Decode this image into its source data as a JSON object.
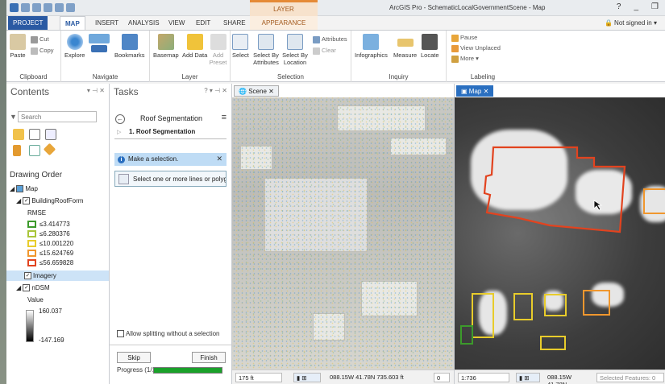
{
  "titlebar": {
    "app_title": "ArcGIS Pro - SchematicLocalGovernmentScene - Map",
    "context_tab": "LAYER",
    "help": "?",
    "minimize": "_",
    "maximize": "❐"
  },
  "tabs": [
    "PROJECT",
    "MAP",
    "INSERT",
    "ANALYSIS",
    "VIEW",
    "EDIT",
    "SHARE",
    "APPEARANCE"
  ],
  "signin": "Not signed in",
  "ribbon": {
    "clipboard": {
      "label": "Clipboard",
      "paste": "Paste",
      "cut": "Cut",
      "copy": "Copy"
    },
    "navigate": {
      "label": "Navigate",
      "explore": "Explore",
      "bookmarks": "Bookmarks"
    },
    "layer": {
      "label": "Layer",
      "basemap": "Basemap",
      "add_data": "Add Data",
      "add_preset": "Add Preset"
    },
    "selection": {
      "label": "Selection",
      "select": "Select",
      "by_attributes": "Select By Attributes",
      "by_location": "Select By Location",
      "attributes": "Attributes",
      "clear": "Clear"
    },
    "inquiry": {
      "label": "Inquiry",
      "infographics": "Infographics",
      "measure": "Measure",
      "locate": "Locate"
    },
    "labeling": {
      "label": "Labeling",
      "pause": "Pause",
      "view_unplaced": "View Unplaced",
      "more": "More"
    }
  },
  "contents": {
    "title": "Contents",
    "search_placeholder": "Search",
    "drawing_order": "Drawing Order",
    "map": "Map",
    "layer1": "BuildingRoofForm",
    "rmse": "RMSE",
    "classes": [
      {
        "label": "≤3.414773",
        "color": "#3c9a2b"
      },
      {
        "label": "≤6.280376",
        "color": "#a9c53a"
      },
      {
        "label": "≤10.001220",
        "color": "#e8cc2b"
      },
      {
        "label": "≤15.624769",
        "color": "#f0972e"
      },
      {
        "label": "≤56.659828",
        "color": "#e2431f"
      }
    ],
    "imagery": "Imagery",
    "ndsm": "nDSM",
    "value": "Value",
    "value_high": "160.037",
    "value_low": "-147.169"
  },
  "tasks": {
    "title": "Tasks",
    "task_name": "Roof Segmentation",
    "step": "1. Roof Segmentation",
    "make_selection": "Make a selection.",
    "select_hint": "Select one or more lines or polygons",
    "allow_split": "Allow splitting without a selection",
    "skip": "Skip",
    "finish": "Finish",
    "progress": "Progress (1/1)",
    "progress_fraction": 1.0
  },
  "scene": {
    "tab": "Scene",
    "scale": "175 ft",
    "coords": "088.15W 41.78N  735.603 ft",
    "count": "0"
  },
  "map": {
    "tab": "Map",
    "scale": "1:736",
    "coords": "088.15W 41.78N",
    "selected": "Selected Features: 0"
  }
}
